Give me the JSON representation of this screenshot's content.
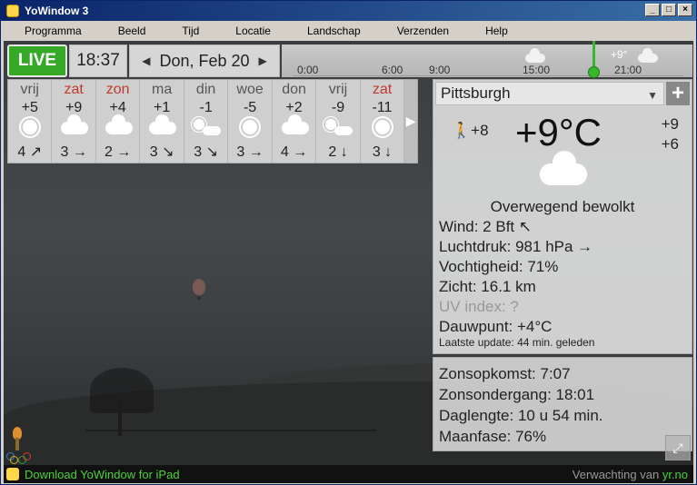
{
  "window": {
    "title": "YoWindow 3",
    "controls": [
      "_",
      "□",
      "×"
    ]
  },
  "menu": [
    "Programma",
    "Beeld",
    "Tijd",
    "Locatie",
    "Landschap",
    "Verzenden",
    "Help"
  ],
  "topbar": {
    "live_label": "LIVE",
    "time": "18:37",
    "date": "Don, Feb 20",
    "prev_arrow": "◀",
    "next_arrow": "▶",
    "timeline_ticks": [
      "0:00",
      "6:00",
      "9:00",
      "15:00",
      "21:00"
    ],
    "timeline_temp": "+9°"
  },
  "forecast": {
    "next_arrow": "▶",
    "days": [
      {
        "name": "vrij",
        "weekend": false,
        "temp": "+5",
        "icon": "sun-icon",
        "wind": "4 ↗"
      },
      {
        "name": "zat",
        "weekend": true,
        "temp": "+9",
        "icon": "cloud-icon",
        "wind": "3 →"
      },
      {
        "name": "zon",
        "weekend": true,
        "temp": "+4",
        "icon": "cloud-icon",
        "wind": "2 →"
      },
      {
        "name": "ma",
        "weekend": false,
        "temp": "+1",
        "icon": "cloud-icon",
        "wind": "3 ↘"
      },
      {
        "name": "din",
        "weekend": false,
        "temp": "-1",
        "icon": "partly-cloudy-icon",
        "wind": "3 ↘"
      },
      {
        "name": "woe",
        "weekend": false,
        "temp": "-5",
        "icon": "sun-icon",
        "wind": "3 →"
      },
      {
        "name": "don",
        "weekend": false,
        "temp": "+2",
        "icon": "cloud-icon",
        "wind": "4 →"
      },
      {
        "name": "vrij",
        "weekend": false,
        "temp": "-9",
        "icon": "partly-cloudy-icon",
        "wind": "2 ↓"
      },
      {
        "name": "zat",
        "weekend": true,
        "temp": "-11",
        "icon": "sun-icon",
        "wind": "3 ↓"
      }
    ]
  },
  "current": {
    "location": "Pittsburgh",
    "add_label": "+",
    "feels_like": "+8",
    "temperature": "+9°C",
    "high": "+9",
    "low": "+6",
    "condition": "Overwegend bewolkt",
    "wind": "Wind:  2 Bft  ↖",
    "pressure": "Luchtdruk:  981 hPa  →",
    "humidity": "Vochtigheid:  71%",
    "visibility": "Zicht:  16.1 km",
    "uv": "UV index:  ?",
    "dewpoint": "Dauwpunt:  +4°C",
    "updated": "Laatste update:  44 min. geleden"
  },
  "sun": {
    "sunrise": "Zonsopkomst:  7:07",
    "sunset": "Zonsondergang:  18:01",
    "daylength": "Daglengte:  10 u 54 min.",
    "moon": "Maanfase:  76%"
  },
  "statusbar": {
    "download": "Download YoWindow for iPad",
    "credit_prefix": "Verwachting van ",
    "credit_source": "yr.no"
  }
}
